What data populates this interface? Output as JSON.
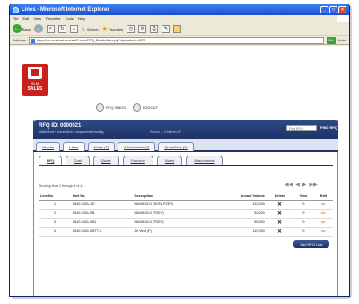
{
  "window": {
    "title": "Lines - Microsoft Internet Explorer",
    "controls": [
      "_",
      "□",
      "×"
    ]
  },
  "menu": [
    "File",
    "Edit",
    "View",
    "Favorites",
    "Tools",
    "Help"
  ],
  "toolbar": {
    "back": "Back",
    "search": "Search",
    "favorites": "Favorites"
  },
  "address": {
    "label": "Address",
    "url": "https://demo.spinal.com/sls/Private/RFQ_Details/lines.jsp?rfqheaderId=4572",
    "go": "Go",
    "links": "Links"
  },
  "app": {
    "logo_sub": "SLM",
    "logo_main": "SALES",
    "nav": [
      "RFQ INBOX",
      "LOGOUT"
    ]
  },
  "rfq": {
    "title": "RFQ ID: 0000021",
    "subtitle": "Mallet Tool+ Automotive Components Holding",
    "parent": "Parent → Children 23",
    "find_placeholder": "Find RFQ",
    "find_label": "FIND RFQ"
  },
  "tabs_main": [
    "Header",
    "Lines",
    "Notes (3)",
    "Attachments (4)",
    "QuoteFlow (4)"
  ],
  "tabs_main_active": 1,
  "tabs_sub": [
    "RFQ",
    "Cost",
    "Quote",
    "Outcome",
    "Notes",
    "Attachments"
  ],
  "tabs_sub_active": 0,
  "showing": "Showing lines 1 through 4 of 4...",
  "pager": [
    "◀◀",
    "◀",
    "▶",
    "▶▶"
  ],
  "table": {
    "columns": [
      "Line No.",
      "Part No.",
      "Description",
      "Annual Volume",
      "Delete",
      "View",
      "Edit"
    ],
    "rows": [
      [
        "1",
        "6540-0431-AD",
        "MANIFOLD (NON_PZEV)",
        "132,000"
      ],
      [
        "2",
        "6540-0431-BB",
        "MANIFOLD (PZEV)",
        "52,000"
      ],
      [
        "3",
        "6540-0431-BB1",
        "MANIFOLD (PZEP)",
        "55,000"
      ],
      [
        "4",
        "6540-0431-BBTT-8",
        "Air Vent (F)",
        "110,000"
      ]
    ]
  },
  "add_button": "Add RFQ Line"
}
